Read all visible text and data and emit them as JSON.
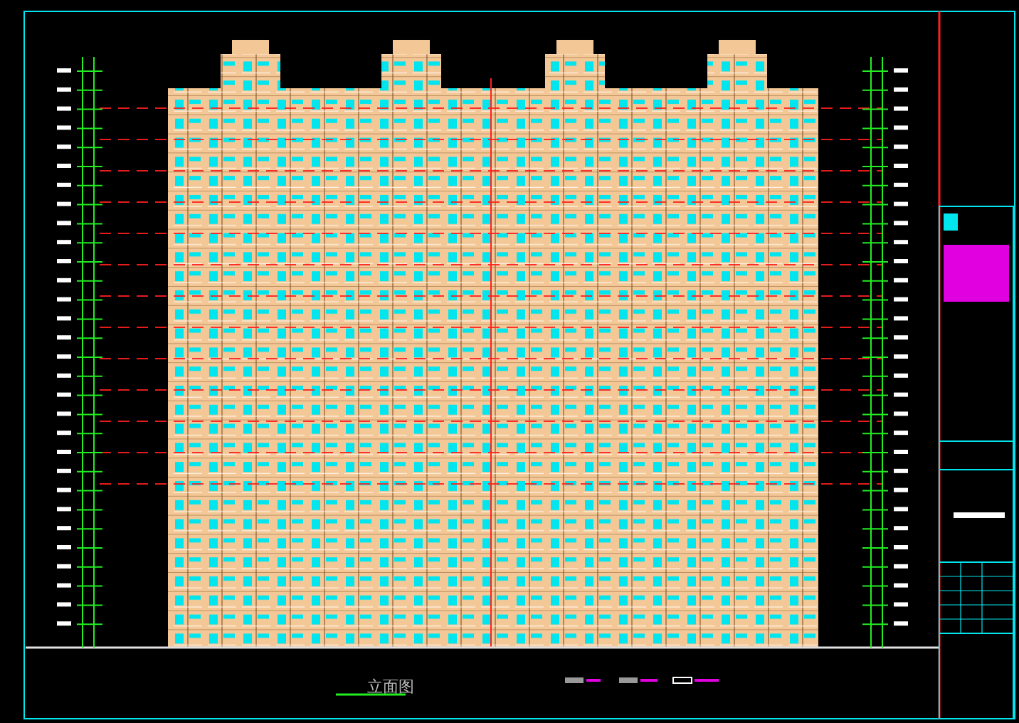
{
  "drawing": {
    "title": "立面图"
  }
}
